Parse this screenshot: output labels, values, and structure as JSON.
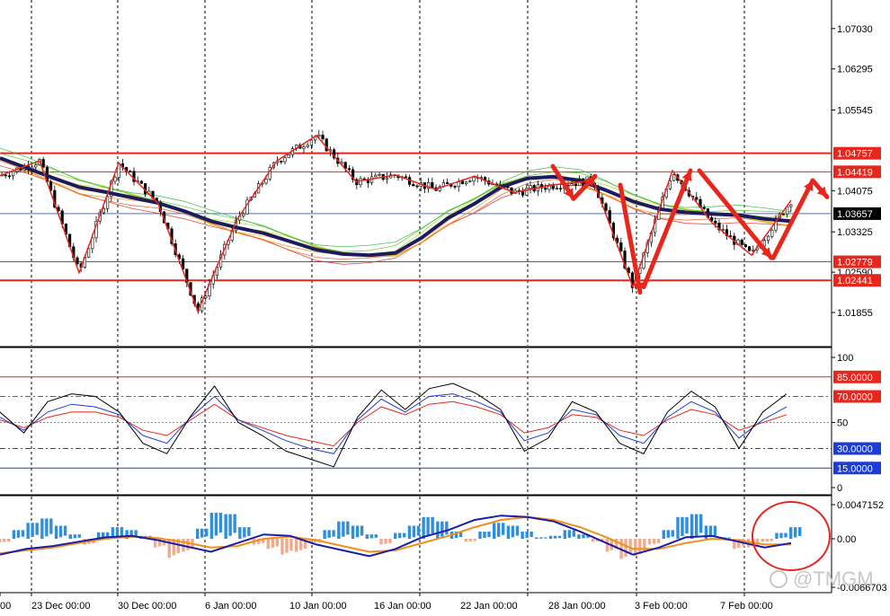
{
  "colors": {
    "background": "#ffffff",
    "grid": "#000000",
    "current_price_line": "#4a6fd1",
    "current_price_tag": "#000000",
    "level_line": "#e8261c",
    "level_tag": "#e8261c",
    "zigzag": "#e8261c",
    "ema_thick": "#1c1c5c",
    "osc_upper_line": "#e8261c",
    "osc_lower_line": "#1c3cd6",
    "osc_tag_red": "#e8261c",
    "osc_tag_blue": "#1c3cd6",
    "macd_hist_pos": "#2f8fdc",
    "macd_hist_neg": "#f3a98c",
    "macd_line": "#1c1ca8",
    "signal_line": "#f0901a",
    "highlight_circle": "#e8261c",
    "watermark": "#c8c8c8"
  },
  "chart_data": [
    {
      "type": "candlestick",
      "pane": "price",
      "y_tick_labels": [
        "1.07030",
        "1.06295",
        "1.05545",
        "1.04075",
        "1.03325",
        "1.02590",
        "1.01855"
      ],
      "ylim": [
        1.0125,
        1.0755
      ],
      "current_price": "1.03657",
      "levels": [
        "1.04757",
        "1.04419",
        "1.02779",
        "1.02441"
      ],
      "zigzag_prices": [
        1.0435,
        1.0462,
        1.0258,
        1.0458,
        1.0384,
        1.0188,
        1.0356,
        1.0462,
        1.0508,
        1.0424,
        1.0436,
        1.041,
        1.0434,
        1.0404,
        1.0418,
        1.0426,
        1.0232,
        1.0444,
        1.0349,
        1.029,
        1.039
      ],
      "ema_slow": [
        1.0467,
        1.0449,
        1.0431,
        1.0414,
        1.0405,
        1.0395,
        1.0385,
        1.037,
        1.0352,
        1.034,
        1.033,
        1.0315,
        1.03,
        1.0292,
        1.029,
        1.0294,
        1.0322,
        1.0358,
        1.0384,
        1.0414,
        1.043,
        1.0433,
        1.0426,
        1.0408,
        1.0388,
        1.0374,
        1.0368,
        1.0365,
        1.0363,
        1.0356,
        1.0352
      ],
      "arrows": [
        {
          "from": [
            1.0452,
            1.0462
          ],
          "to": [
            1.0393,
            1.0384
          ]
        },
        {
          "from": [
            1.0393,
            1.0384
          ],
          "to": [
            1.0434,
            1.0434
          ]
        },
        {
          "from": [
            1.0418,
            1.0418
          ],
          "to": [
            1.0222,
            1.0222
          ]
        },
        {
          "from": [
            1.0232,
            1.0232
          ],
          "to": [
            1.0444,
            1.0444
          ]
        },
        {
          "from": [
            1.0444,
            1.0444
          ],
          "to": [
            1.0285,
            1.0285
          ]
        },
        {
          "from": [
            1.0285,
            1.0285
          ],
          "to": [
            1.0426,
            1.0426
          ]
        },
        {
          "from": [
            1.0426,
            1.0426
          ],
          "to": [
            1.0396,
            1.0396
          ]
        }
      ]
    },
    {
      "type": "line",
      "pane": "oscillator",
      "y_tick_labels": [
        "100",
        "50",
        "0"
      ],
      "ylim": [
        0,
        100
      ],
      "levels": [
        "85.0000",
        "70.0000",
        "30.0000",
        "15.0000"
      ],
      "level_values": [
        85,
        70,
        30,
        15
      ],
      "series_black": [
        58,
        42,
        66,
        72,
        70,
        58,
        34,
        26,
        55,
        78,
        50,
        40,
        28,
        22,
        16,
        54,
        75,
        60,
        76,
        80,
        72,
        60,
        28,
        38,
        66,
        58,
        34,
        26,
        58,
        74,
        62,
        30,
        58,
        72
      ],
      "series_blue": [
        54,
        44,
        58,
        64,
        62,
        56,
        40,
        34,
        54,
        70,
        52,
        44,
        36,
        30,
        26,
        52,
        68,
        58,
        70,
        72,
        66,
        58,
        36,
        42,
        60,
        56,
        40,
        34,
        54,
        66,
        58,
        38,
        52,
        62
      ],
      "series_red": [
        52,
        46,
        54,
        58,
        58,
        54,
        44,
        40,
        52,
        64,
        52,
        46,
        40,
        36,
        32,
        50,
        62,
        56,
        64,
        66,
        62,
        56,
        42,
        46,
        56,
        54,
        44,
        40,
        52,
        60,
        56,
        44,
        50,
        56
      ]
    },
    {
      "type": "bar",
      "pane": "macd",
      "y_tick_labels": [
        "0.0047152",
        "0.00",
        "-0.0066703"
      ],
      "ylim": [
        -0.0066703,
        0.0047152
      ],
      "histogram": [
        -0.0005,
        0.0012,
        0.0022,
        0.0028,
        0.0018,
        0.0006,
        -0.0008,
        0.0009,
        0.0016,
        0.0012,
        0.0004,
        -0.0012,
        -0.0026,
        -0.0018,
        0.0014,
        0.0036,
        0.0034,
        0.0016,
        -0.0008,
        -0.0014,
        -0.0022,
        -0.0018,
        -0.0006,
        0.0012,
        0.0024,
        0.0018,
        0.0006,
        -0.0008,
        0.0008,
        0.0018,
        0.003,
        0.0024,
        0.001,
        -0.0004,
        0.001,
        0.0022,
        0.0018,
        0.001,
        0.0002,
        0.0004,
        0.0012,
        0.0006,
        -0.0004,
        -0.0018,
        -0.0028,
        -0.0024,
        -0.0008,
        0.0012,
        0.003,
        0.0034,
        0.0018,
        0.0002,
        -0.0014,
        -0.0012,
        -0.0004,
        0.0008,
        0.0016
      ],
      "macd": [
        -0.0022,
        -0.0014,
        -0.001,
        -0.0004,
        0.0002,
        0.0004,
        -0.0002,
        -0.001,
        -0.0018,
        -0.0006,
        0.0006,
        0.0004,
        -0.0008,
        -0.0016,
        -0.0024,
        -0.0014,
        0.0002,
        0.0012,
        0.0026,
        0.0032,
        0.003,
        0.0024,
        0.001,
        -0.0006,
        -0.0022,
        -0.0012,
        0.0002,
        0.0004,
        -0.0004,
        -0.0012,
        -0.0006
      ],
      "signal": [
        -0.002,
        -0.0016,
        -0.0012,
        -0.0006,
        0.0,
        0.0003,
        0.0001,
        -0.0005,
        -0.0012,
        -0.001,
        0.0,
        0.0003,
        -0.0002,
        -0.001,
        -0.0018,
        -0.0016,
        -0.0006,
        0.0004,
        0.0016,
        0.0026,
        0.003,
        0.0026,
        0.0016,
        0.0002,
        -0.0014,
        -0.0014,
        -0.0006,
        0.0,
        -0.0002,
        -0.0008,
        -0.0008
      ]
    }
  ],
  "x_axis": {
    "labels": [
      "00",
      "23 Dec 00:00",
      "30 Dec 00:00",
      "6 Jan 00:00",
      "10 Jan 00:00",
      "16 Jan 00:00",
      "22 Jan 00:00",
      "28 Jan 00:00",
      "3 Feb 00:00",
      "7 Feb 00:00"
    ]
  },
  "watermark": "@TMGM"
}
